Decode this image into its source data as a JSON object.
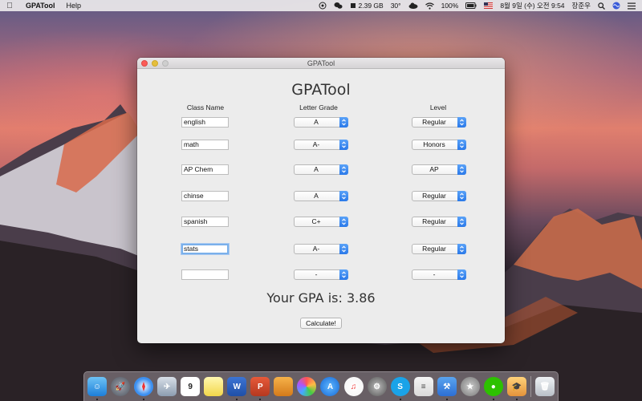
{
  "menubar": {
    "app_name": "GPATool",
    "menus": [
      "Help"
    ],
    "status": {
      "memory": "2.39 GB",
      "temperature": "30°",
      "battery": "100%",
      "date_time": "8월 9일 (수) 오전 9:54",
      "user": "장준우"
    }
  },
  "window": {
    "title": "GPATool",
    "heading": "GPATool",
    "headers": {
      "class_name": "Class Name",
      "letter_grade": "Letter Grade",
      "level": "Level"
    },
    "rows": [
      {
        "class_name": "english",
        "grade": "A",
        "level": "Regular"
      },
      {
        "class_name": "math",
        "grade": "A-",
        "level": "Honors"
      },
      {
        "class_name": "AP Chem",
        "grade": "A",
        "level": "AP"
      },
      {
        "class_name": "chinse",
        "grade": "A",
        "level": "Regular"
      },
      {
        "class_name": "spanish",
        "grade": "C+",
        "level": "Regular"
      },
      {
        "class_name": "stats",
        "grade": "A-",
        "level": "Regular"
      },
      {
        "class_name": "",
        "grade": "-",
        "level": "-"
      }
    ],
    "gpa_text": "Your GPA is: 3.86",
    "calculate_label": "Calculate!"
  },
  "colors": {
    "accent": "#2f7ff0",
    "focus_ring": "#7ab0ea"
  }
}
